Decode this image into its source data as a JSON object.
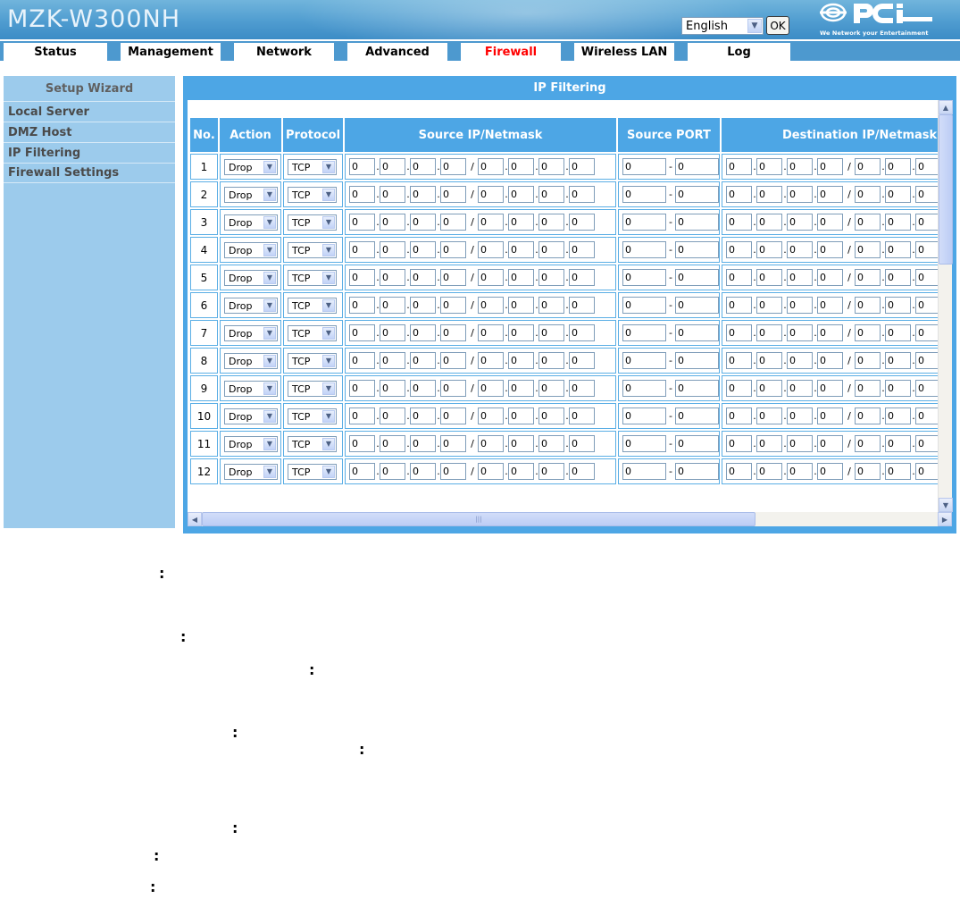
{
  "header": {
    "model": "MZK-W300NH",
    "language_value": "English",
    "ok_label": "OK",
    "logo_text": "PCi",
    "logo_tagline": "We Network your Entertainment"
  },
  "nav": {
    "tabs": [
      {
        "label": "Status"
      },
      {
        "label": "Management"
      },
      {
        "label": "Network"
      },
      {
        "label": "Advanced"
      },
      {
        "label": "Firewall",
        "active": true
      },
      {
        "label": "Wireless LAN"
      },
      {
        "label": "Log"
      }
    ]
  },
  "sidebar": {
    "title": "Setup Wizard",
    "items": [
      "Local Server",
      "DMZ Host",
      "IP Filtering",
      "Firewall Settings"
    ]
  },
  "panel": {
    "title": "IP Filtering",
    "columns": [
      "No.",
      "Action",
      "Protocol",
      "Source IP/Netmask",
      "Source PORT",
      "Destination IP/Netmask"
    ],
    "rows": [
      {
        "no": "1",
        "action": "Drop",
        "protocol": "TCP",
        "src_ip": [
          "0",
          "0",
          "0",
          "0"
        ],
        "src_mask": [
          "0",
          "0",
          "0",
          "0"
        ],
        "src_port": [
          "0",
          "0"
        ],
        "dst_ip": [
          "0",
          "0",
          "0",
          "0"
        ],
        "dst_mask": [
          "0",
          "0",
          "0"
        ]
      },
      {
        "no": "2",
        "action": "Drop",
        "protocol": "TCP",
        "src_ip": [
          "0",
          "0",
          "0",
          "0"
        ],
        "src_mask": [
          "0",
          "0",
          "0",
          "0"
        ],
        "src_port": [
          "0",
          "0"
        ],
        "dst_ip": [
          "0",
          "0",
          "0",
          "0"
        ],
        "dst_mask": [
          "0",
          "0",
          "0"
        ]
      },
      {
        "no": "3",
        "action": "Drop",
        "protocol": "TCP",
        "src_ip": [
          "0",
          "0",
          "0",
          "0"
        ],
        "src_mask": [
          "0",
          "0",
          "0",
          "0"
        ],
        "src_port": [
          "0",
          "0"
        ],
        "dst_ip": [
          "0",
          "0",
          "0",
          "0"
        ],
        "dst_mask": [
          "0",
          "0",
          "0"
        ]
      },
      {
        "no": "4",
        "action": "Drop",
        "protocol": "TCP",
        "src_ip": [
          "0",
          "0",
          "0",
          "0"
        ],
        "src_mask": [
          "0",
          "0",
          "0",
          "0"
        ],
        "src_port": [
          "0",
          "0"
        ],
        "dst_ip": [
          "0",
          "0",
          "0",
          "0"
        ],
        "dst_mask": [
          "0",
          "0",
          "0"
        ]
      },
      {
        "no": "5",
        "action": "Drop",
        "protocol": "TCP",
        "src_ip": [
          "0",
          "0",
          "0",
          "0"
        ],
        "src_mask": [
          "0",
          "0",
          "0",
          "0"
        ],
        "src_port": [
          "0",
          "0"
        ],
        "dst_ip": [
          "0",
          "0",
          "0",
          "0"
        ],
        "dst_mask": [
          "0",
          "0",
          "0"
        ]
      },
      {
        "no": "6",
        "action": "Drop",
        "protocol": "TCP",
        "src_ip": [
          "0",
          "0",
          "0",
          "0"
        ],
        "src_mask": [
          "0",
          "0",
          "0",
          "0"
        ],
        "src_port": [
          "0",
          "0"
        ],
        "dst_ip": [
          "0",
          "0",
          "0",
          "0"
        ],
        "dst_mask": [
          "0",
          "0",
          "0"
        ]
      },
      {
        "no": "7",
        "action": "Drop",
        "protocol": "TCP",
        "src_ip": [
          "0",
          "0",
          "0",
          "0"
        ],
        "src_mask": [
          "0",
          "0",
          "0",
          "0"
        ],
        "src_port": [
          "0",
          "0"
        ],
        "dst_ip": [
          "0",
          "0",
          "0",
          "0"
        ],
        "dst_mask": [
          "0",
          "0",
          "0"
        ]
      },
      {
        "no": "8",
        "action": "Drop",
        "protocol": "TCP",
        "src_ip": [
          "0",
          "0",
          "0",
          "0"
        ],
        "src_mask": [
          "0",
          "0",
          "0",
          "0"
        ],
        "src_port": [
          "0",
          "0"
        ],
        "dst_ip": [
          "0",
          "0",
          "0",
          "0"
        ],
        "dst_mask": [
          "0",
          "0",
          "0"
        ]
      },
      {
        "no": "9",
        "action": "Drop",
        "protocol": "TCP",
        "src_ip": [
          "0",
          "0",
          "0",
          "0"
        ],
        "src_mask": [
          "0",
          "0",
          "0",
          "0"
        ],
        "src_port": [
          "0",
          "0"
        ],
        "dst_ip": [
          "0",
          "0",
          "0",
          "0"
        ],
        "dst_mask": [
          "0",
          "0",
          "0"
        ]
      },
      {
        "no": "10",
        "action": "Drop",
        "protocol": "TCP",
        "src_ip": [
          "0",
          "0",
          "0",
          "0"
        ],
        "src_mask": [
          "0",
          "0",
          "0",
          "0"
        ],
        "src_port": [
          "0",
          "0"
        ],
        "dst_ip": [
          "0",
          "0",
          "0",
          "0"
        ],
        "dst_mask": [
          "0",
          "0",
          "0"
        ]
      },
      {
        "no": "11",
        "action": "Drop",
        "protocol": "TCP",
        "src_ip": [
          "0",
          "0",
          "0",
          "0"
        ],
        "src_mask": [
          "0",
          "0",
          "0",
          "0"
        ],
        "src_port": [
          "0",
          "0"
        ],
        "dst_ip": [
          "0",
          "0",
          "0",
          "0"
        ],
        "dst_mask": [
          "0",
          "0",
          "0"
        ]
      },
      {
        "no": "12",
        "action": "Drop",
        "protocol": "TCP",
        "src_ip": [
          "0",
          "0",
          "0",
          "0"
        ],
        "src_mask": [
          "0",
          "0",
          "0",
          "0"
        ],
        "src_port": [
          "0",
          "0"
        ],
        "dst_ip": [
          "0",
          "0",
          "0",
          "0"
        ],
        "dst_mask": [
          "0",
          "0",
          "0"
        ]
      }
    ]
  },
  "below": {
    "colons": [
      ":",
      ":",
      ":",
      ":",
      ":",
      ":",
      ":",
      ":"
    ]
  },
  "colors": {
    "banner": "#4f9cd0",
    "panel": "#4da6e5",
    "sidebar": "#9ccbec",
    "active_tab": "#ff0000"
  },
  "icons": {
    "dropdown": "chevron-down-icon",
    "scroll_up": "arrow-up-icon",
    "scroll_down": "arrow-down-icon",
    "scroll_left": "arrow-left-icon",
    "scroll_right": "arrow-right-icon"
  }
}
